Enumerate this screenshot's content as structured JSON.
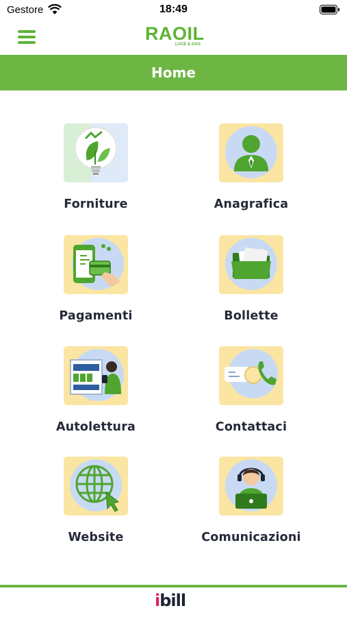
{
  "status_bar": {
    "carrier": "Gestore",
    "time": "18:49"
  },
  "header": {
    "logo_text": "RAOIL",
    "logo_subtext": "LUCE & GAS"
  },
  "title_bar": {
    "title": "Home"
  },
  "colors": {
    "brand_green": "#6db644",
    "icon_tile_bg": "#fbe5a3",
    "icon_circle_bg": "#c8daf3",
    "label_text": "#252a3a"
  },
  "menu": {
    "items": [
      {
        "label": "Forniture",
        "icon": "lightbulb-leaf-icon"
      },
      {
        "label": "Anagrafica",
        "icon": "user-profile-icon"
      },
      {
        "label": "Pagamenti",
        "icon": "card-payment-icon"
      },
      {
        "label": "Bollette",
        "icon": "folder-icon"
      },
      {
        "label": "Autolettura",
        "icon": "meter-reading-icon"
      },
      {
        "label": "Contattaci",
        "icon": "phone-contact-icon"
      },
      {
        "label": "Website",
        "icon": "globe-icon"
      },
      {
        "label": "Comunicazioni",
        "icon": "operator-headset-icon"
      }
    ]
  },
  "footer": {
    "brand_prefix": "i",
    "brand_suffix": "bill"
  }
}
